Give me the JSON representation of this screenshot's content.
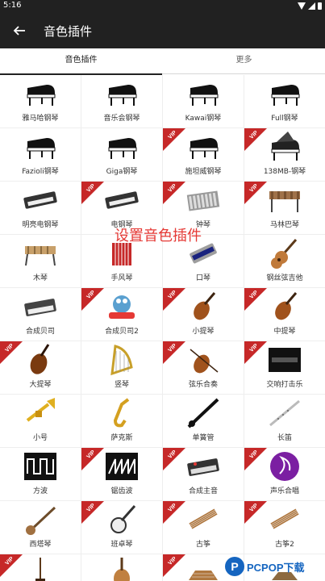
{
  "status": {
    "time": "5:16"
  },
  "app_bar": {
    "title": "音色插件"
  },
  "tabs": [
    {
      "label": "音色插件",
      "active": true
    },
    {
      "label": "更多",
      "active": false
    }
  ],
  "overlay_text": "设置音色插件",
  "vip_label": "VIP",
  "items": [
    {
      "label": "雅马哈钢琴",
      "icon": "grand-piano",
      "vip": false
    },
    {
      "label": "音乐会钢琴",
      "icon": "grand-piano",
      "vip": false
    },
    {
      "label": "Kawai钢琴",
      "icon": "grand-piano",
      "vip": false
    },
    {
      "label": "Full钢琴",
      "icon": "grand-piano",
      "vip": false
    },
    {
      "label": "Fazioli钢琴",
      "icon": "grand-piano",
      "vip": false
    },
    {
      "label": "Giga钢琴",
      "icon": "grand-piano",
      "vip": false
    },
    {
      "label": "施坦威钢琴",
      "icon": "grand-piano",
      "vip": true
    },
    {
      "label": "138MB-钢琴",
      "icon": "grand-piano-open",
      "vip": true
    },
    {
      "label": "明亮电钢琴",
      "icon": "keyboard",
      "vip": false
    },
    {
      "label": "电钢琴",
      "icon": "keyboard",
      "vip": true
    },
    {
      "label": "钟琴",
      "icon": "glockenspiel",
      "vip": true
    },
    {
      "label": "马林巴琴",
      "icon": "marimba",
      "vip": true
    },
    {
      "label": "木琴",
      "icon": "xylophone",
      "vip": false
    },
    {
      "label": "手风琴",
      "icon": "accordion",
      "vip": false
    },
    {
      "label": "口琴",
      "icon": "harmonica",
      "vip": false
    },
    {
      "label": "钢丝弦吉他",
      "icon": "guitar",
      "vip": false
    },
    {
      "label": "合成贝司",
      "icon": "synth",
      "vip": false
    },
    {
      "label": "合成贝司2",
      "icon": "crazy-frog",
      "vip": true
    },
    {
      "label": "小提琴",
      "icon": "violin",
      "vip": true
    },
    {
      "label": "中提琴",
      "icon": "violin",
      "vip": true
    },
    {
      "label": "大提琴",
      "icon": "cello",
      "vip": true
    },
    {
      "label": "竖琴",
      "icon": "harp",
      "vip": false
    },
    {
      "label": "弦乐合奏",
      "icon": "violin-bow",
      "vip": true
    },
    {
      "label": "交响打击乐",
      "icon": "orchestra-logo",
      "vip": true
    },
    {
      "label": "小号",
      "icon": "trumpet",
      "vip": false
    },
    {
      "label": "萨克斯",
      "icon": "saxophone",
      "vip": false
    },
    {
      "label": "单簧管",
      "icon": "clarinet",
      "vip": false
    },
    {
      "label": "长笛",
      "icon": "flute",
      "vip": false
    },
    {
      "label": "方波",
      "icon": "square-wave",
      "vip": false
    },
    {
      "label": "锯齿波",
      "icon": "sawtooth-wave",
      "vip": true
    },
    {
      "label": "合成主音",
      "icon": "synth-lead",
      "vip": true
    },
    {
      "label": "声乐合唱",
      "icon": "choir-logo",
      "vip": true
    },
    {
      "label": "西塔琴",
      "icon": "sitar",
      "vip": false
    },
    {
      "label": "班卓琴",
      "icon": "banjo",
      "vip": true
    },
    {
      "label": "古筝",
      "icon": "guzheng",
      "vip": true
    },
    {
      "label": "古筝2",
      "icon": "guzheng",
      "vip": true
    },
    {
      "label": "",
      "icon": "erhu",
      "vip": true
    },
    {
      "label": "",
      "icon": "pipa",
      "vip": false
    },
    {
      "label": "",
      "icon": "yangqin",
      "vip": true
    },
    {
      "label": "",
      "icon": "dulcimer",
      "vip": false
    }
  ],
  "watermark": {
    "logo_letter": "P",
    "text": "PCPOP下载"
  }
}
